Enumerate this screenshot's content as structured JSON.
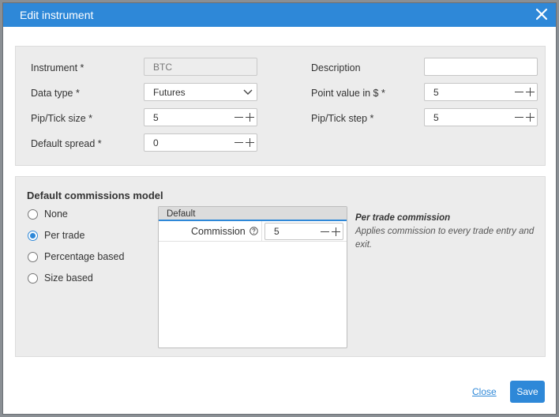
{
  "dialog": {
    "title": "Edit instrument",
    "close_icon": "close-icon",
    "accent_color": "#2e88d8"
  },
  "instrument_panel": {
    "instrument": {
      "label": "Instrument *",
      "value": "BTC",
      "disabled": true
    },
    "data_type": {
      "label": "Data type *",
      "value": "Futures",
      "icon": "chevron-down-icon"
    },
    "pip_tick_size": {
      "label": "Pip/Tick size *",
      "value": "5"
    },
    "default_spread": {
      "label": "Default spread *",
      "value": "0"
    },
    "description": {
      "label": "Description",
      "value": ""
    },
    "point_value": {
      "label": "Point value in $ *",
      "value": "5"
    },
    "pip_tick_step": {
      "label": "Pip/Tick step *",
      "value": "5"
    }
  },
  "commissions": {
    "title": "Default commissions model",
    "options": [
      {
        "label": "None",
        "checked": false
      },
      {
        "label": "Per trade",
        "checked": true
      },
      {
        "label": "Percentage based",
        "checked": false
      },
      {
        "label": "Size based",
        "checked": false
      }
    ],
    "grid": {
      "header": "Default",
      "row_label": "Commission",
      "help_icon": "question-circle-icon",
      "value": "5"
    },
    "description": {
      "title": "Per trade commission",
      "text": "Applies commission to every trade entry and exit."
    }
  },
  "footer": {
    "close_label": "Close",
    "save_label": "Save"
  }
}
